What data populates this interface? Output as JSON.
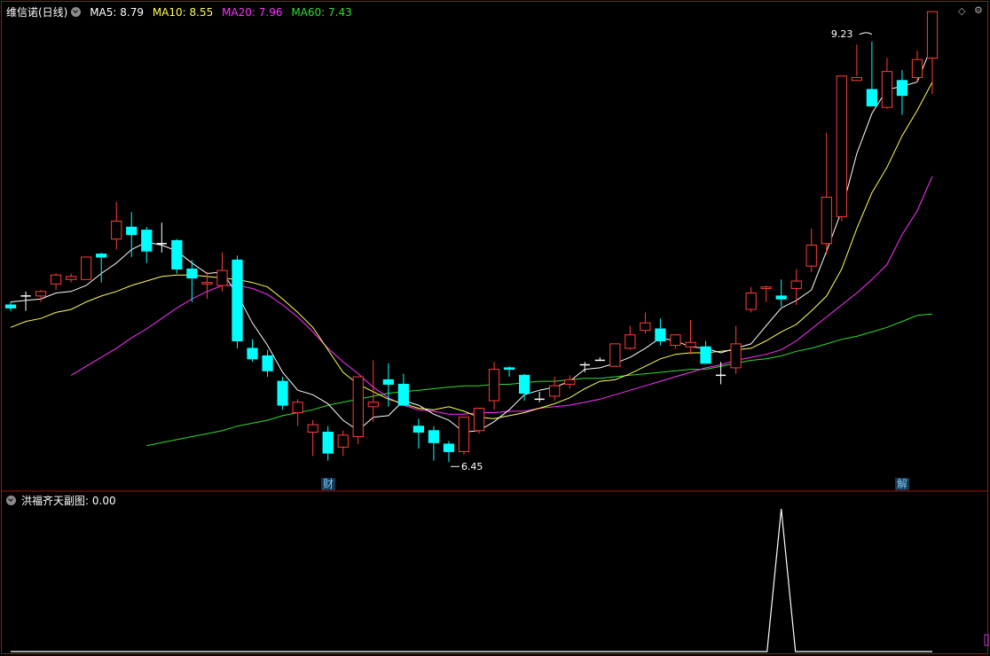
{
  "main_header": {
    "title": "维信诺(日线)",
    "ma5": "MA5: 8.79",
    "ma10": "MA10: 8.55",
    "ma20": "MA20: 7.96",
    "ma60": "MA60: 7.43"
  },
  "sub_header": {
    "title": "洪福齐天副图",
    "value": ": 0.00"
  },
  "markers": {
    "left": "财",
    "right": "解"
  },
  "annotations": {
    "high": "9.23",
    "low": "6.45"
  },
  "colors": {
    "up": "#ff3d3d",
    "down": "#00ffff",
    "flat": "#ffffff",
    "ma5": "#ffffff",
    "ma10": "#ffff55",
    "ma20": "#ff33ff",
    "ma60": "#33dd33",
    "border": "#aa1111"
  },
  "chart_data": {
    "type": "candlestick",
    "title": "维信诺(日线)",
    "ohlc": [
      [
        7.49,
        7.51,
        7.45,
        7.47
      ],
      [
        7.55,
        7.58,
        7.45,
        7.55
      ],
      [
        7.55,
        7.59,
        7.51,
        7.58
      ],
      [
        7.63,
        7.7,
        7.59,
        7.69
      ],
      [
        7.66,
        7.7,
        7.64,
        7.68
      ],
      [
        7.66,
        7.81,
        7.66,
        7.81
      ],
      [
        7.83,
        7.84,
        7.64,
        7.81
      ],
      [
        7.93,
        8.18,
        7.86,
        8.05
      ],
      [
        8.01,
        8.11,
        7.81,
        7.96
      ],
      [
        7.99,
        8.01,
        7.77,
        7.85
      ],
      [
        7.9,
        8.04,
        7.84,
        7.9
      ],
      [
        7.92,
        7.93,
        7.7,
        7.73
      ],
      [
        7.73,
        7.79,
        7.51,
        7.67
      ],
      [
        7.63,
        7.71,
        7.53,
        7.64
      ],
      [
        7.62,
        7.84,
        7.58,
        7.72
      ],
      [
        7.79,
        7.82,
        7.2,
        7.25
      ],
      [
        7.2,
        7.26,
        7.11,
        7.13
      ],
      [
        7.15,
        7.19,
        7.01,
        7.05
      ],
      [
        6.98,
        7.01,
        6.79,
        6.82
      ],
      [
        6.77,
        6.86,
        6.68,
        6.84
      ],
      [
        6.64,
        6.72,
        6.48,
        6.69
      ],
      [
        6.64,
        6.68,
        6.45,
        6.5
      ],
      [
        6.54,
        6.65,
        6.48,
        6.62
      ],
      [
        6.61,
        6.87,
        6.56,
        7.01
      ],
      [
        6.81,
        7.12,
        6.71,
        6.84
      ],
      [
        6.99,
        7.1,
        6.81,
        6.96
      ],
      [
        6.96,
        7.03,
        6.82,
        6.82
      ],
      [
        6.68,
        6.73,
        6.53,
        6.64
      ],
      [
        6.65,
        6.68,
        6.45,
        6.57
      ],
      [
        6.56,
        6.58,
        6.44,
        6.51
      ],
      [
        6.51,
        6.71,
        6.49,
        6.74
      ],
      [
        6.65,
        6.8,
        6.63,
        6.8
      ],
      [
        6.85,
        7.11,
        6.79,
        7.06
      ],
      [
        7.07,
        7.08,
        7.01,
        7.06
      ],
      [
        7.02,
        7.03,
        6.85,
        6.9
      ],
      [
        6.86,
        6.91,
        6.84,
        6.86
      ],
      [
        6.88,
        7.01,
        6.85,
        6.95
      ],
      [
        6.96,
        7.02,
        6.93,
        6.99
      ],
      [
        7.09,
        7.11,
        7.04,
        7.09
      ],
      [
        7.12,
        7.14,
        7.12,
        7.12
      ],
      [
        7.08,
        7.21,
        7.08,
        7.23
      ],
      [
        7.2,
        7.35,
        7.19,
        7.29
      ],
      [
        7.32,
        7.44,
        7.3,
        7.37
      ],
      [
        7.33,
        7.4,
        7.22,
        7.25
      ],
      [
        7.22,
        7.29,
        7.2,
        7.29
      ],
      [
        7.21,
        7.39,
        7.16,
        7.24
      ],
      [
        7.21,
        7.25,
        7.13,
        7.1
      ],
      [
        7.02,
        7.11,
        6.96,
        7.02
      ],
      [
        7.07,
        7.35,
        7.03,
        7.23
      ],
      [
        7.46,
        7.61,
        7.44,
        7.57
      ],
      [
        7.6,
        7.62,
        7.51,
        7.61
      ],
      [
        7.55,
        7.66,
        7.48,
        7.53
      ],
      [
        7.6,
        7.73,
        7.49,
        7.65
      ],
      [
        7.75,
        8.0,
        7.71,
        7.89
      ],
      [
        7.9,
        8.64,
        7.83,
        8.21
      ],
      [
        8.08,
        8.99,
        8.05,
        9.02
      ],
      [
        8.99,
        9.23,
        9.02,
        9.01
      ],
      [
        8.93,
        9.25,
        8.92,
        8.82
      ],
      [
        8.81,
        9.14,
        8.8,
        9.05
      ],
      [
        8.99,
        9.06,
        8.76,
        8.89
      ],
      [
        9.01,
        9.19,
        8.98,
        9.13
      ],
      [
        9.14,
        9.23,
        8.9,
        9.45
      ]
    ],
    "ma5": [
      7.51,
      7.52,
      7.53,
      7.57,
      7.58,
      7.62,
      7.7,
      7.77,
      7.86,
      7.91,
      7.89,
      7.85,
      7.77,
      7.7,
      7.71,
      7.56,
      7.37,
      7.22,
      7.04,
      6.92,
      6.89,
      6.83,
      6.72,
      6.65,
      6.74,
      6.75,
      6.85,
      6.82,
      6.76,
      6.72,
      6.64,
      6.65,
      6.71,
      6.79,
      6.89,
      6.92,
      6.94,
      6.98,
      7.06,
      7.07,
      7.1,
      7.14,
      7.2,
      7.27,
      7.25,
      7.21,
      7.2,
      7.17,
      7.2,
      7.23,
      7.35,
      7.47,
      7.52,
      7.59,
      7.85,
      8.12,
      8.5,
      8.77,
      8.93,
      8.95,
      8.98,
      9.23
    ],
    "ma10": [
      7.34,
      7.38,
      7.4,
      7.44,
      7.46,
      7.51,
      7.55,
      7.58,
      7.62,
      7.65,
      7.68,
      7.69,
      7.69,
      7.68,
      7.67,
      7.66,
      7.64,
      7.61,
      7.53,
      7.44,
      7.34,
      7.19,
      7.04,
      6.96,
      6.91,
      6.86,
      6.83,
      6.8,
      6.79,
      6.81,
      6.78,
      6.74,
      6.73,
      6.75,
      6.77,
      6.8,
      6.83,
      6.87,
      6.93,
      6.98,
      6.99,
      7.03,
      7.08,
      7.13,
      7.16,
      7.17,
      7.17,
      7.18,
      7.19,
      7.2,
      7.25,
      7.31,
      7.36,
      7.45,
      7.55,
      7.73,
      8.0,
      8.24,
      8.41,
      8.62,
      8.79,
      8.98
    ],
    "ma20": [
      7.02,
      7.08,
      7.14,
      7.2,
      7.27,
      7.33,
      7.4,
      7.47,
      7.53,
      7.58,
      7.62,
      7.62,
      7.6,
      7.56,
      7.49,
      7.41,
      7.31,
      7.2,
      7.11,
      7.03,
      6.94,
      6.87,
      6.82,
      6.79,
      6.78,
      6.76,
      6.76,
      6.77,
      6.77,
      6.78,
      6.78,
      6.8,
      6.81,
      6.82,
      6.84,
      6.86,
      6.89,
      6.92,
      6.95,
      6.98,
      7.01,
      7.04,
      7.07,
      7.09,
      7.12,
      7.14,
      7.16,
      7.19,
      7.25,
      7.33,
      7.41,
      7.49,
      7.57,
      7.66,
      7.76,
      7.96,
      8.12,
      8.35
    ],
    "ma60": [
      6.55,
      6.57,
      6.59,
      6.61,
      6.63,
      6.65,
      6.68,
      6.7,
      6.72,
      6.75,
      6.77,
      6.79,
      6.82,
      6.84,
      6.86,
      6.88,
      6.9,
      6.91,
      6.92,
      6.93,
      6.94,
      6.95,
      6.95,
      6.96,
      6.96,
      6.97,
      6.98,
      6.98,
      6.99,
      7.0,
      7.0,
      7.01,
      7.02,
      7.03,
      7.04,
      7.05,
      7.06,
      7.06,
      7.08,
      7.1,
      7.12,
      7.13,
      7.15,
      7.18,
      7.2,
      7.23,
      7.26,
      7.28,
      7.31,
      7.34,
      7.38,
      7.42,
      7.43
    ],
    "indicator": {
      "name": "洪福齐天副图",
      "peak_index": 51,
      "peak_value": 1,
      "values_note_baseline": 0
    },
    "ylim": [
      6.4,
      9.35
    ]
  }
}
